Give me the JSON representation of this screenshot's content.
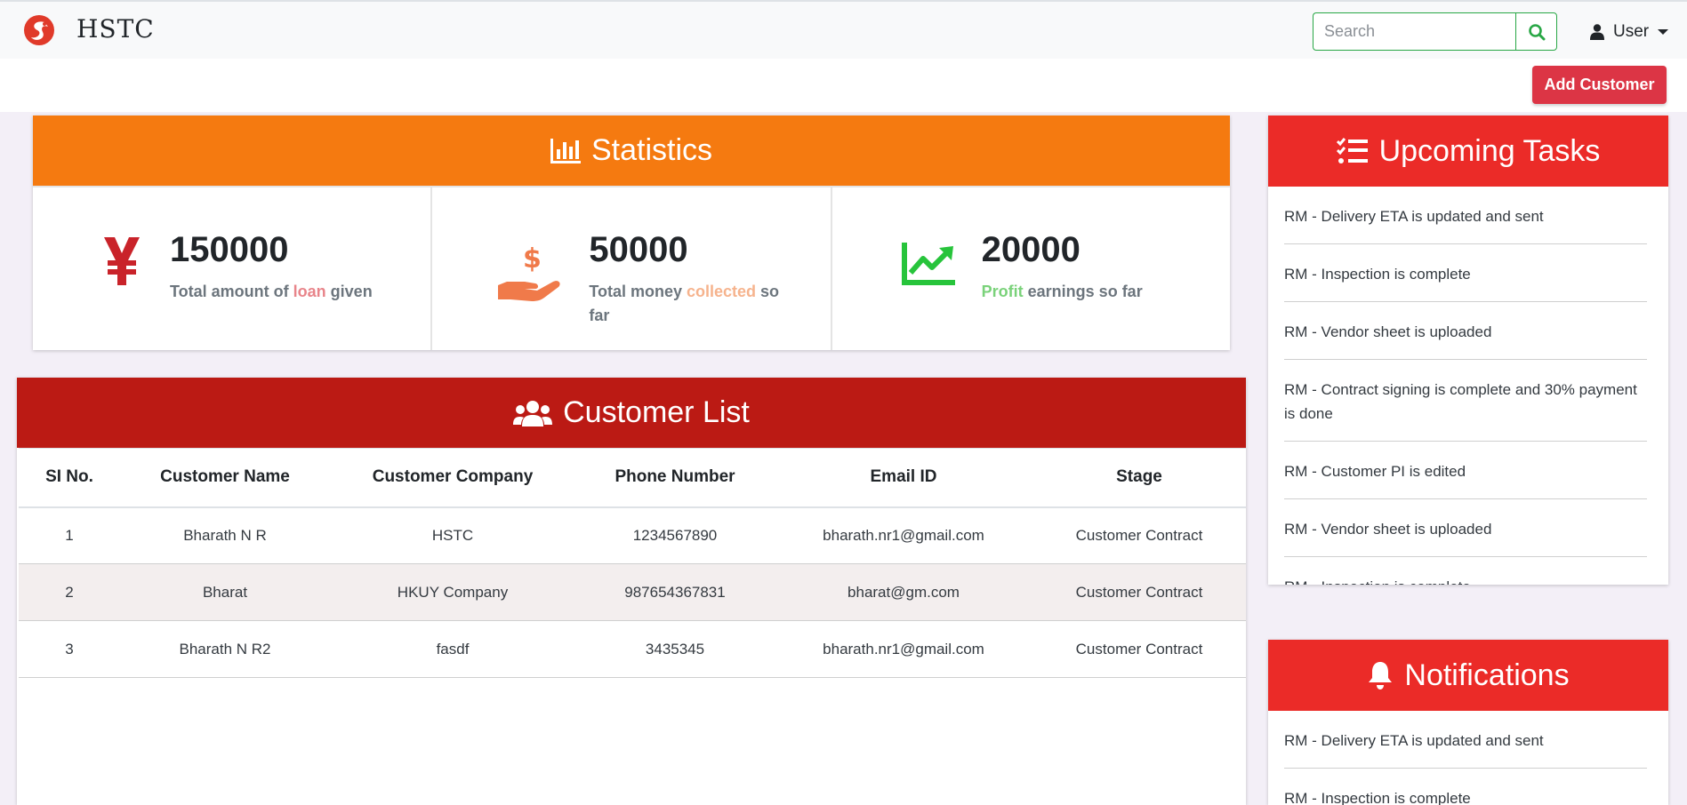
{
  "navbar": {
    "brand": "HSTC",
    "search_placeholder": "Search",
    "user_label": "User"
  },
  "actions": {
    "add_customer_label": "Add Customer"
  },
  "statistics": {
    "title": "Statistics",
    "items": [
      {
        "value": "150000",
        "label_prefix": "Total amount of ",
        "label_highlight": "loan",
        "label_suffix": " given",
        "icon": "yen-icon",
        "color": "#c9232a"
      },
      {
        "value": "50000",
        "label_prefix": "Total money ",
        "label_highlight": "collected",
        "label_suffix": " so far",
        "icon": "hand-holding-dollar-icon",
        "color": "#f07a4a"
      },
      {
        "value": "20000",
        "label_prefix": "",
        "label_highlight": "Profit",
        "label_suffix": " earnings so far",
        "icon": "chart-line-icon",
        "color": "#27c43b"
      }
    ]
  },
  "customer_list": {
    "title": "Customer List",
    "columns": [
      "SI No.",
      "Customer Name",
      "Customer Company",
      "Phone Number",
      "Email ID",
      "Stage"
    ],
    "rows": [
      [
        "1",
        "Bharath N R",
        "HSTC",
        "1234567890",
        "bharath.nr1@gmail.com",
        "Customer Contract"
      ],
      [
        "2",
        "Bharat",
        "HKUY Company",
        "987654367831",
        "bharat@gm.com",
        "Customer Contract"
      ],
      [
        "3",
        "Bharath N R2",
        "fasdf",
        "3435345",
        "bharath.nr1@gmail.com",
        "Customer Contract"
      ]
    ]
  },
  "upcoming_tasks": {
    "title": "Upcoming Tasks",
    "items": [
      "RM - Delivery ETA is updated and sent",
      "RM - Inspection is complete",
      "RM - Vendor sheet is uploaded",
      "RM - Contract signing is complete and 30% payment is done",
      "RM - Customer PI is edited",
      "RM - Vendor sheet is uploaded",
      "RM - Inspection is complete"
    ]
  },
  "notifications": {
    "title": "Notifications",
    "items": [
      "RM - Delivery ETA is updated and sent",
      "RM - Inspection is complete"
    ]
  },
  "colors": {
    "stats_header": "#f57a10",
    "customer_header": "#bb1a14",
    "side_header": "#eb2b28",
    "accent_green": "#28a745",
    "danger": "#dc3545"
  }
}
